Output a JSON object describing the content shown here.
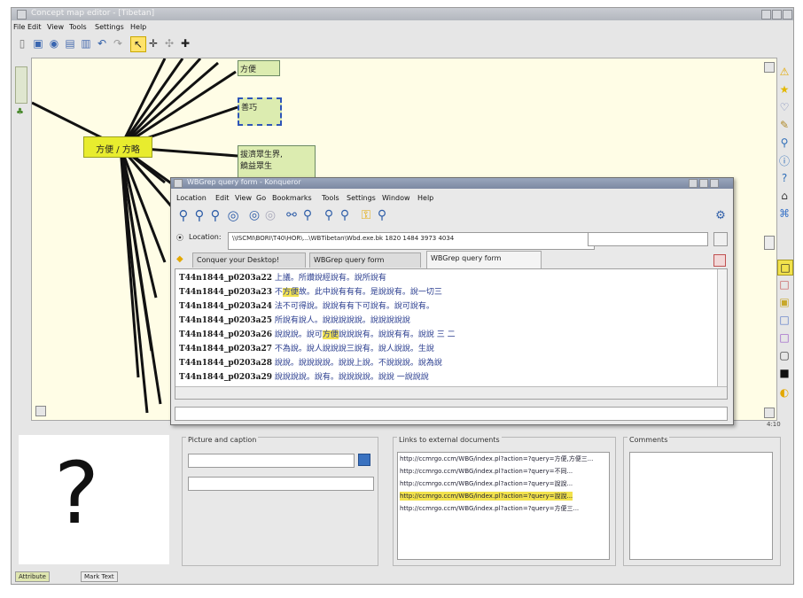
{
  "window": {
    "title": "Concept map editor - [Tibetan]"
  },
  "menubar": [
    "File",
    "Edit",
    "View",
    "Tools",
    "Settings",
    "Help"
  ],
  "left_tab": "Tree View",
  "map": {
    "center_node": "方便 / 方略",
    "nodes": [
      "方便",
      "善巧",
      "拔濟眾生界,\n饒益眾生"
    ]
  },
  "query_window": {
    "title": "WBGrep query form - Konqueror",
    "menu": [
      "Location",
      "Edit",
      "View",
      "Go",
      "Bookmarks",
      "Tools",
      "Settings",
      "Window",
      "Help"
    ],
    "location_label": "Location:",
    "location_value": "\\\\ISCMI\\BORI\\T40\\HOR\\...\\WBTibetan\\Wbd.exe.bk 1820 1484 3973 4034",
    "tabs": [
      "Conquer your Desktop!",
      "WBGrep query form",
      "WBGrep query form"
    ],
    "results": [
      {
        "id": "T44n1844_p0203a22",
        "pre": "上議。所讚說經說有。",
        "hl": "",
        "post": "說所說有"
      },
      {
        "id": "T44n1844_p0203a23",
        "pre": "不",
        "hl": "方便",
        "post": "故。此中說有有有。是說說有。說一切三"
      },
      {
        "id": "T44n1844_p0203a24",
        "pre": "法不可得說。說說有有下可說有。說可說有。",
        "hl": "",
        "post": ""
      },
      {
        "id": "T44n1844_p0203a25",
        "pre": "所說有說人。說說說說說。說說說說說",
        "hl": "",
        "post": ""
      },
      {
        "id": "T44n1844_p0203a26",
        "pre": "說說說。說可",
        "hl": "方便",
        "post": "說說說有。說說有有。說說 三 二"
      },
      {
        "id": "T44n1844_p0203a27",
        "pre": "不為說。說人說說說三說有。說人說說。生說",
        "hl": "",
        "post": ""
      },
      {
        "id": "T44n1844_p0203a28",
        "pre": "說說。說說說說。說說上說。不說說說。說為說",
        "hl": "",
        "post": ""
      },
      {
        "id": "T44n1844_p0203a29",
        "pre": "說說說說。說有。說說說說。說說 一說說說",
        "hl": "",
        "post": ""
      }
    ]
  },
  "bottom": {
    "picture_title": "Picture and caption",
    "links_title": "Links to external documents",
    "comments_title": "Comments",
    "links": [
      "http://ccmrgo.ccm/WBG/index.pl?action=?query=方便,方便三...",
      "http://ccmrgo.ccm/WBG/index.pl?action=?query=不同...",
      "http://ccmrgo.ccm/WBG/index.pl?action=?query=說說...",
      "http://ccmrgo.ccm/WBG/index.pl?action=?query=說說...",
      "http://ccmrgo.ccm/WBG/index.pl?action=?query=方便三..."
    ],
    "selected_link_index": 3,
    "placeholder_glyph": "?"
  },
  "status": {
    "zoom": "4:10",
    "buttons": [
      "Attribute",
      "Mark Text"
    ]
  },
  "colors": {
    "canvas": "#fffde6",
    "node": "#dcecb0",
    "center_node": "#e8ec2e",
    "highlight": "#f2e250"
  }
}
